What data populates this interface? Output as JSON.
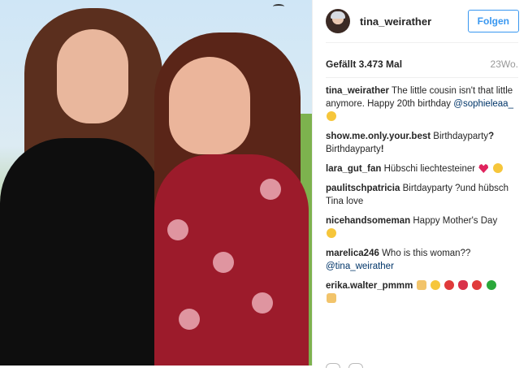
{
  "post": {
    "username": "tina_weirather",
    "follow_label": "Folgen",
    "likes_text": "Gefällt 3.473 Mal",
    "time_ago": "23Wo."
  },
  "comments": [
    {
      "user": "tina_weirather",
      "text": "The little cousin isn't that little anymore. Happy 20th birthday ",
      "mention": "@sophieleaa_",
      "emoji": [
        "kissing-face"
      ]
    },
    {
      "user": "show.me.only.your.best",
      "text": "Birthdayparty",
      "text2": "Birthdayparty",
      "question_mark": "?",
      "exclaim": "!"
    },
    {
      "user": "lara_gut_fan",
      "text": "Hübschi liechtesteiner",
      "emoji": [
        "red-heart",
        "smiling-face"
      ]
    },
    {
      "user": "paulitschpatricia",
      "text": "Birtdayparty ?und hübsch Tina love"
    },
    {
      "user": "nicehandsomeman",
      "text": "Happy Mother's Day",
      "emoji": [
        "kissing-face"
      ]
    },
    {
      "user": "marelica246",
      "text": "Who is this woman??",
      "mention": "@tina_weirather"
    },
    {
      "user": "erika.walter_pmmm",
      "emoji": [
        "victory-hand",
        "bouquet",
        "lips",
        "rose",
        "kiss-mark",
        "four-leaf-clover",
        "thumbs-up"
      ]
    }
  ],
  "colors": {
    "accent": "#3897f0",
    "link": "#003569",
    "muted": "#999999"
  }
}
